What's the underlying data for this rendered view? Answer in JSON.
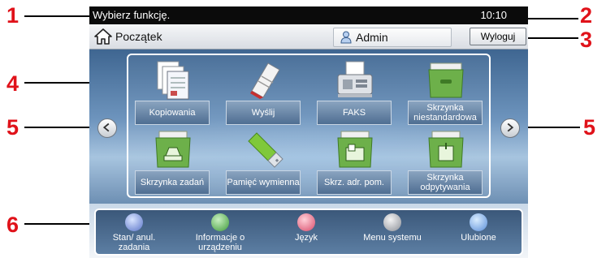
{
  "callouts": [
    "1",
    "2",
    "3",
    "4",
    "5",
    "5",
    "6"
  ],
  "status": {
    "message": "Wybierz funkcję.",
    "time": "10:10"
  },
  "header": {
    "home_label": "Początek",
    "user_label": "Admin",
    "logout_label": "Wyloguj"
  },
  "functions": [
    {
      "label": "Kopiowania",
      "icon": "copy-icon"
    },
    {
      "label": "Wyślij",
      "icon": "send-icon"
    },
    {
      "label": "FAKS",
      "icon": "fax-icon"
    },
    {
      "label": "Skrzynka niestandardowa",
      "icon": "custom-box-icon"
    },
    {
      "label": "Skrzynka zadań",
      "icon": "job-box-icon"
    },
    {
      "label": "Pamięć wymienna",
      "icon": "usb-memory-icon"
    },
    {
      "label": "Skrz. adr. pom.",
      "icon": "subaddress-box-icon"
    },
    {
      "label": "Skrzynka odpytywania",
      "icon": "polling-box-icon"
    }
  ],
  "quick_bar": [
    {
      "label": "Stan/ anul. zadania",
      "icon": "status-icon"
    },
    {
      "label": "Informacje o urządzeniu",
      "icon": "device-info-icon"
    },
    {
      "label": "Język",
      "icon": "language-icon"
    },
    {
      "label": "Menu systemu",
      "icon": "system-menu-icon"
    },
    {
      "label": "Ulubione",
      "icon": "favorites-icon"
    }
  ],
  "colors": {
    "callout": "#e0121a",
    "status_bar": "#0b0b0b",
    "quick_bar": "#3b587a"
  }
}
